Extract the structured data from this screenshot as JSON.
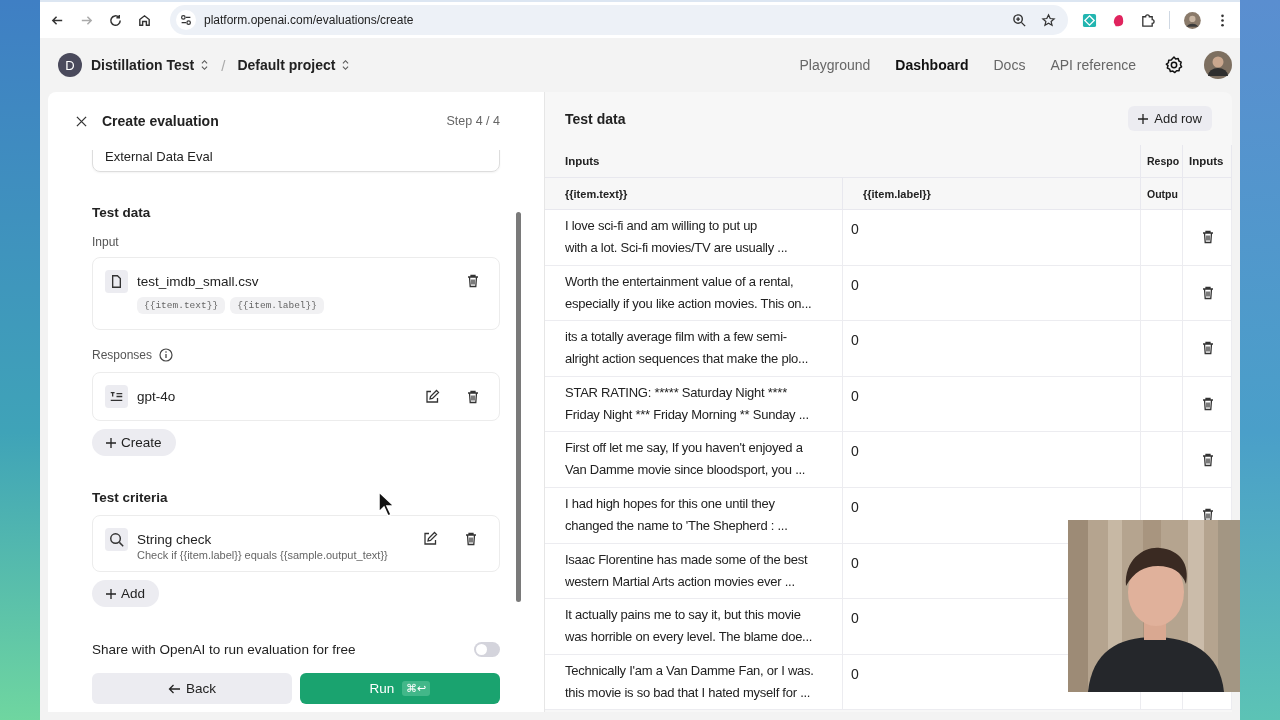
{
  "browser": {
    "url": "platform.openai.com/evaluations/create"
  },
  "header": {
    "org": {
      "initial": "D",
      "name": "Distillation Test"
    },
    "separator": "/",
    "project": "Default project",
    "nav": [
      {
        "label": "Playground",
        "selected": false
      },
      {
        "label": "Dashboard",
        "selected": true
      },
      {
        "label": "Docs",
        "selected": false
      },
      {
        "label": "API reference",
        "selected": false
      }
    ]
  },
  "left_panel": {
    "title": "Create evaluation",
    "step": "Step 4 / 4",
    "name_field": {
      "value": "External Data Eval"
    },
    "test_data": {
      "heading": "Test data",
      "input_label": "Input",
      "file": {
        "name": "test_imdb_small.csv",
        "tags": [
          "{{item.text}}",
          "{{item.label}}"
        ]
      },
      "responses_label": "Responses",
      "responses": [
        {
          "name": "gpt-4o"
        }
      ],
      "create_button": "Create"
    },
    "criteria": {
      "heading": "Test criteria",
      "items": [
        {
          "title": "String check",
          "description": "Check if {{item.label}} equals {{sample.output_text}}"
        }
      ],
      "add_button": "Add"
    },
    "share": {
      "label": "Share with OpenAI to run evaluation for free",
      "on": false
    },
    "back_button": "Back",
    "run_button": {
      "label": "Run",
      "shortcut": "⌘↩"
    }
  },
  "right_panel": {
    "title": "Test data",
    "add_row_button": "Add row",
    "table": {
      "group_headers": [
        {
          "label": "Inputs"
        },
        {
          "label": "Respo"
        },
        {
          "label": "Inputs"
        }
      ],
      "columns": [
        "{{item.text}}",
        "{{item.label}}",
        "Outpu"
      ],
      "rows": [
        {
          "text": "I love sci-fi and am willing to put up\nwith a lot. Sci-fi movies/TV are usually ...",
          "label": "0",
          "delete": true
        },
        {
          "text": "Worth the entertainment value of a rental,\nespecially if you like action movies. This on...",
          "label": "0",
          "delete": true
        },
        {
          "text": "its a totally average film with a few semi-\nalright action sequences that make the plo...",
          "label": "0",
          "delete": true
        },
        {
          "text": "STAR RATING: ***** Saturday Night ****\nFriday Night *** Friday Morning ** Sunday ...",
          "label": "0",
          "delete": true
        },
        {
          "text": "First off let me say, If you haven't enjoyed a\nVan Damme movie since bloodsport, you ...",
          "label": "0",
          "delete": true
        },
        {
          "text": "I had high hopes for this one until they\nchanged the name to 'The Shepherd : ...",
          "label": "0",
          "delete": true
        },
        {
          "text": "Isaac Florentine has made some of the best\nwestern Martial Arts action movies ever ...",
          "label": "0"
        },
        {
          "text": "It actually pains me to say it, but this movie\nwas horrible on every level. The blame doe...",
          "label": "0"
        },
        {
          "text": "Technically I'am a Van Damme Fan, or I was.\nthis movie is so bad that I hated myself for ...",
          "label": "0"
        }
      ]
    }
  }
}
